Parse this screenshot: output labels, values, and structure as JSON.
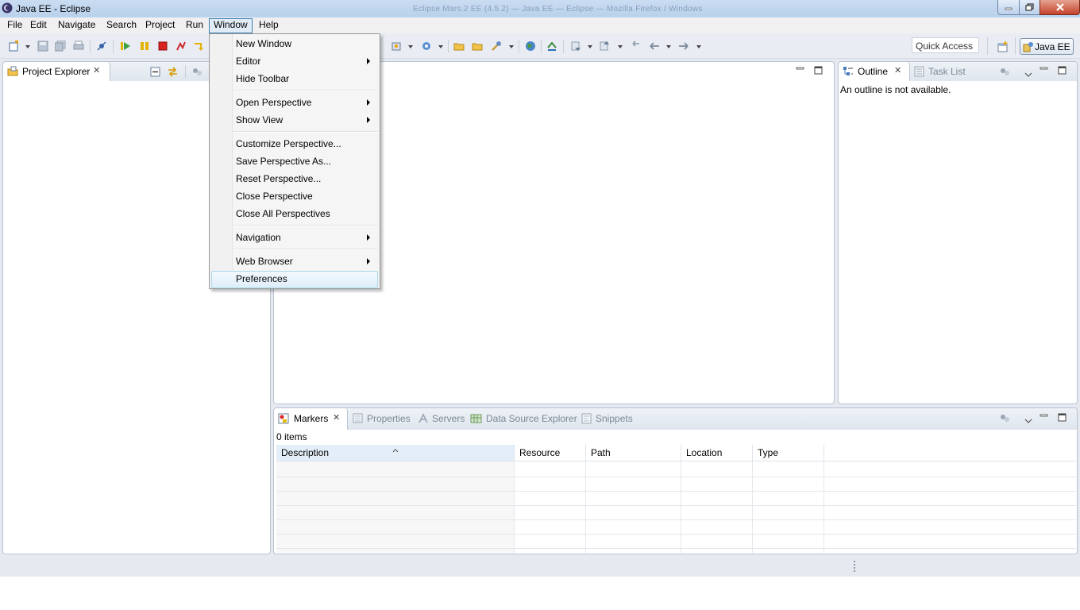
{
  "window": {
    "title": "Java EE - Eclipse",
    "ghost_title": "Eclipse Mars.2 EE (4.5.2) — Java EE — Eclipse — Mozilla Firefox / Windows"
  },
  "menubar": {
    "items": [
      "File",
      "Edit",
      "Navigate",
      "Search",
      "Project",
      "Run",
      "Window",
      "Help"
    ],
    "active": "Window"
  },
  "toolbar": {
    "quick_access": "Quick Access",
    "perspective": "Java EE"
  },
  "project_explorer": {
    "title": "Project Explorer"
  },
  "outline": {
    "title": "Outline",
    "tab2": "Task List",
    "message": "An outline is not available."
  },
  "bottom_panel": {
    "tabs": [
      "Markers",
      "Properties",
      "Servers",
      "Data Source Explorer",
      "Snippets"
    ],
    "count": "0 items",
    "columns": [
      "Description",
      "Resource",
      "Path",
      "Location",
      "Type"
    ]
  },
  "window_menu": {
    "items": [
      {
        "label": "New Window",
        "submenu": false
      },
      {
        "label": "Editor",
        "submenu": true
      },
      {
        "label": "Hide Toolbar",
        "submenu": false
      },
      {
        "label": "Open Perspective",
        "submenu": true
      },
      {
        "label": "Show View",
        "submenu": true
      },
      {
        "label": "Customize Perspective...",
        "submenu": false
      },
      {
        "label": "Save Perspective As...",
        "submenu": false
      },
      {
        "label": "Reset Perspective...",
        "submenu": false
      },
      {
        "label": "Close Perspective",
        "submenu": false
      },
      {
        "label": "Close All Perspectives",
        "submenu": false
      },
      {
        "label": "Navigation",
        "submenu": true
      },
      {
        "label": "Web Browser",
        "submenu": true
      },
      {
        "label": "Preferences",
        "submenu": false
      }
    ],
    "highlighted": "Preferences"
  },
  "colors": {
    "accent": "#3c7fb1",
    "panel_border": "#b8c4d2",
    "workbench_bg": "#e6eaf0"
  }
}
